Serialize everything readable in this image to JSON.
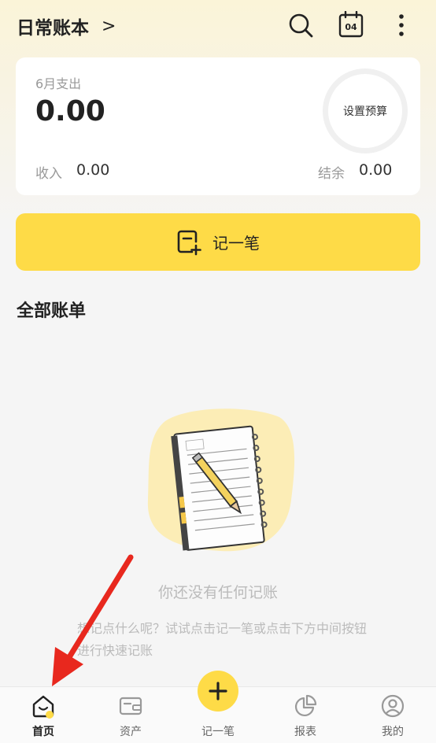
{
  "header": {
    "book_title": "日常账本",
    "chevron": ">",
    "calendar_day": "04"
  },
  "summary": {
    "month_label": "6月支出",
    "month_expense": "0.00",
    "budget_label": "设置预算",
    "income_label": "收入",
    "income_value": "0.00",
    "balance_label": "结余",
    "balance_value": "0.00"
  },
  "record_button": {
    "label": "记一笔"
  },
  "bills": {
    "section_title": "全部账单",
    "empty_title": "你还没有任何记账",
    "empty_hint": "想记点什么呢？试试点击记一笔或点击下方中间按钮进行快速记账"
  },
  "tabbar": {
    "items": [
      {
        "label": "首页",
        "icon": "home-icon",
        "active": true
      },
      {
        "label": "资产",
        "icon": "wallet-icon",
        "active": false
      },
      {
        "label": "记一笔",
        "icon": "plus-icon",
        "active": false
      },
      {
        "label": "报表",
        "icon": "pie-chart-icon",
        "active": false
      },
      {
        "label": "我的",
        "icon": "user-icon",
        "active": false
      }
    ]
  },
  "colors": {
    "accent": "#fedb47",
    "arrow": "#e8281e"
  }
}
